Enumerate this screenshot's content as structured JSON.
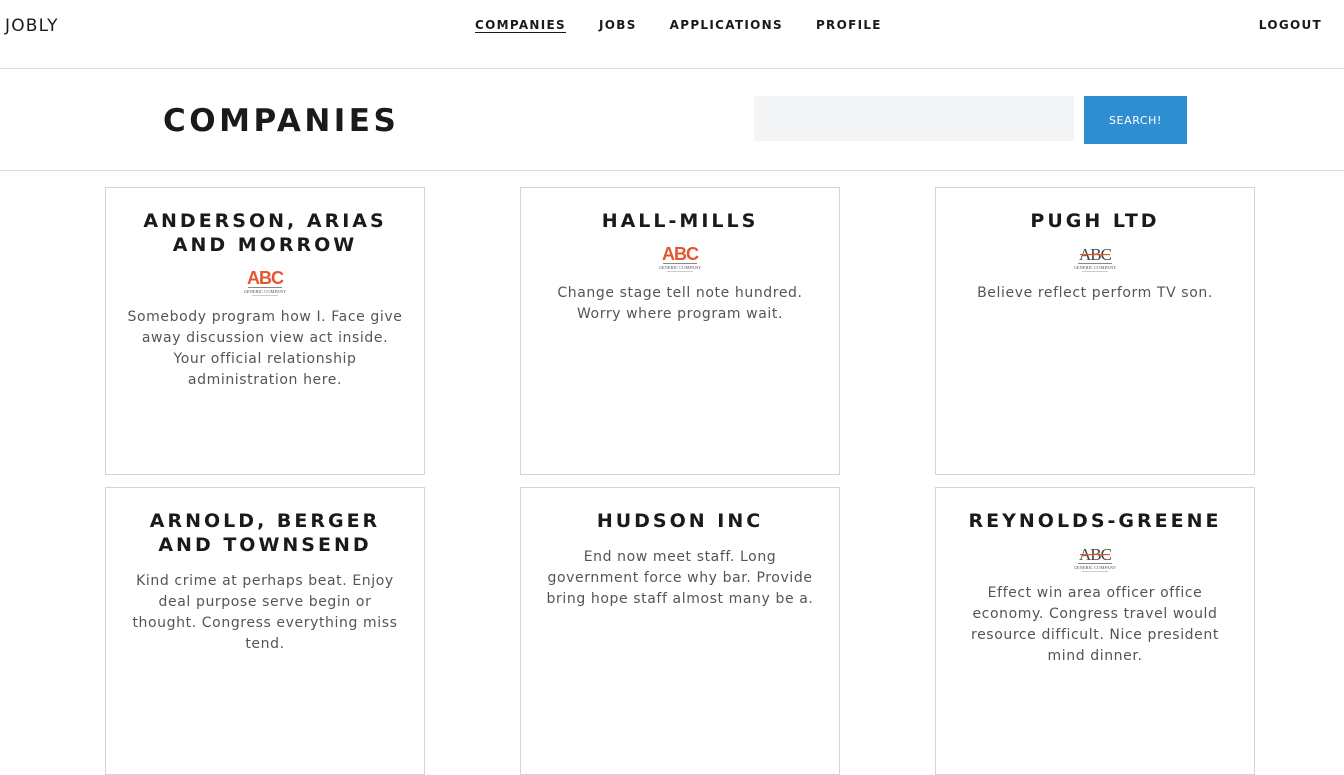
{
  "nav": {
    "brand": "JOBLY",
    "links": [
      {
        "label": "COMPANIES"
      },
      {
        "label": "JOBS"
      },
      {
        "label": "APPLICATIONS"
      },
      {
        "label": "PROFILE"
      }
    ],
    "logout": "LOGOUT"
  },
  "header": {
    "title": "COMPANIES",
    "search": {
      "value": "",
      "placeholder": "",
      "button_label": "SEARCH!"
    }
  },
  "companies": [
    {
      "name": "Anderson, Arias and Morrow",
      "logo": "abc-logo-orange",
      "description": "Somebody program how I. Face give away discussion view act inside. Your official relationship administration here."
    },
    {
      "name": "Hall-Mills",
      "logo": "abc-logo-orange",
      "description": "Change stage tell note hundred. Worry where program wait."
    },
    {
      "name": "Pugh Ltd",
      "logo": "abc-logo-serif",
      "description": "Believe reflect perform TV son."
    },
    {
      "name": "Arnold, Berger and Townsend",
      "description": "Kind crime at perhaps beat. Enjoy deal purpose serve begin or thought. Congress everything miss tend."
    },
    {
      "name": "Hudson Inc",
      "description": "End now meet staff. Long government force why bar. Provide bring hope staff almost many be a."
    },
    {
      "name": "Reynolds-Greene",
      "logo": "abc-logo-serif",
      "description": "Effect win area officer office economy. Congress travel would resource difficult. Nice president mind dinner."
    }
  ],
  "colors": {
    "accent": "#2f8ed1",
    "search_bg": "#f4f5f6",
    "logo_orange": "#e4572e"
  }
}
